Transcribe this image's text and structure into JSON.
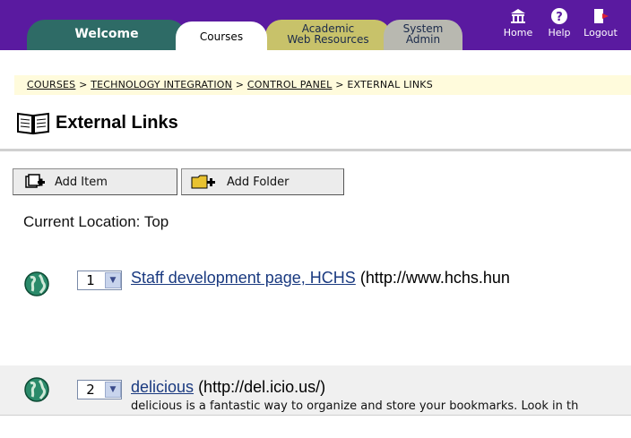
{
  "tabs": {
    "welcome": "Welcome",
    "courses": "Courses",
    "academic_line1": "Academic",
    "academic_line2": "Web Resources",
    "system_line1": "System",
    "system_line2": "Admin"
  },
  "topnav": {
    "home": "Home",
    "help": "Help",
    "logout": "Logout"
  },
  "breadcrumb": {
    "courses": "COURSES",
    "course": "TECHNOLOGY INTEGRATION",
    "control_panel": "CONTROL PANEL",
    "current": "EXTERNAL LINKS",
    "separator": ">"
  },
  "page_title": "External Links",
  "actions": {
    "add_item": "Add Item",
    "add_folder": "Add Folder"
  },
  "current_location": "Current Location: Top",
  "items": [
    {
      "order": "1",
      "title": "Staff development page, HCHS",
      "url": "(http://www.hchs.hun",
      "description": ""
    },
    {
      "order": "2",
      "title": "delicious",
      "url": "(http://del.icio.us/)",
      "description": "delicious is a fantastic way to organize and store your bookmarks. Look in th"
    }
  ],
  "colors": {
    "topbar": "#5a1aa0",
    "welcome_tab": "#2e6b66",
    "academic_tab": "#c8c26a",
    "system_tab": "#b8b8b0",
    "link": "#1a3a80"
  }
}
